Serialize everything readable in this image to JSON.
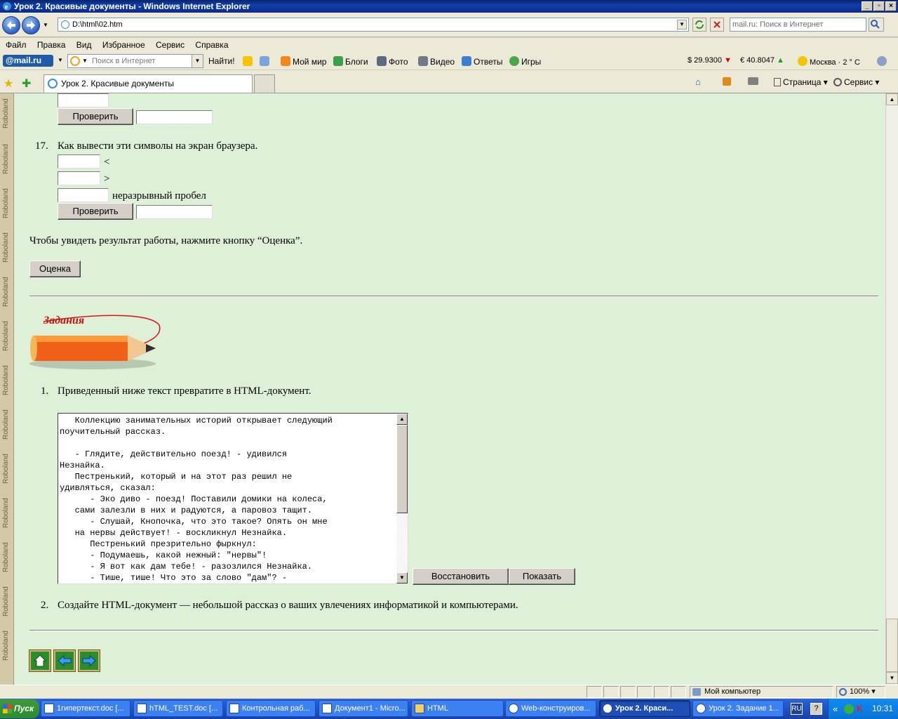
{
  "window": {
    "title": "Урок 2. Красивые документы - Windows Internet Explorer"
  },
  "address": {
    "url": "D:\\html\\02.htm",
    "search_placeholder": "mail.ru: Поиск в Интернет"
  },
  "menu": [
    "Файл",
    "Правка",
    "Вид",
    "Избранное",
    "Сервис",
    "Справка"
  ],
  "mailbar": {
    "logo": "@mail.ru",
    "search_placeholder": "Поиск в Интернет",
    "find_button": "Найти!",
    "links": [
      "Мой мир",
      "Блоги",
      "Фото",
      "Видео",
      "Ответы",
      "Игры"
    ],
    "usd": "$ 29.9300",
    "eur": "€ 40.8047",
    "weather": "Москва · 2 ° C",
    "colors": {
      "down": "#d80000",
      "up": "#1f9b1f"
    }
  },
  "tabs": {
    "active": "Урок 2. Красивые документы",
    "page_menu": "Страница",
    "tools_menu": "Сервис"
  },
  "content": {
    "sidebar_text": "Roboland",
    "check_label": "Проверить",
    "q17": {
      "num": "17.",
      "text": "Как вывести эти символы на экран браузера.",
      "sym1": "<",
      "sym2": ">",
      "sym3": "неразрывный пробел"
    },
    "result_text": "Чтобы увидеть результат работы, нажмите кнопку “Оценка”.",
    "grade_button": "Оценка",
    "tasks_logo": "Задания",
    "task1": {
      "num": "1.",
      "text": "Приведенный ниже текст превратите в HTML-документ."
    },
    "textarea": "   Коллекцию занимательных историй открывает следующий\nпоучительный рассказ.\n\n   - Глядите, действительно поезд! - удивился\nНезнайка.\n   Пестренький, который и на этот раз решил не\nудивляться, сказал:\n      - Эко диво - поезд! Поставили домики на колеса,\n   сами залезли в них и радуются, а паровоз тащит.\n      - Слушай, Кнопочка, что это такое? Опять он мне\n   на нервы действует! - воскликнул Незнайка.\n      Пестренький презрительно фыркнул:\n      - Подумаешь, какой нежный: \"нервы\"!\n      - Я вот как дам тебе! - разозлился Незнайка.\n      - Тише, тише! Что это за слово \"дам\"? -",
    "restore_button": "Восстановить",
    "show_button": "Показать",
    "task2": {
      "num": "2.",
      "text": "Создайте HTML-документ — небольшой рассказ о ваших увлечениях информатикой и компьютерами."
    }
  },
  "status": {
    "zone": "Мой компьютер",
    "zoom": "100%"
  },
  "taskbar": {
    "start": "Пуск",
    "tasks": [
      "1гипертекст.doc [...",
      "hTML_TEST.doc [...",
      "Контрольная раб...",
      "Документ1 - Micro...",
      "HTML",
      "Web-конструиров...",
      "Урок 2. Краси...",
      "Урок 2. Задание 1..."
    ],
    "lang": "RU",
    "clock": "10:31"
  }
}
